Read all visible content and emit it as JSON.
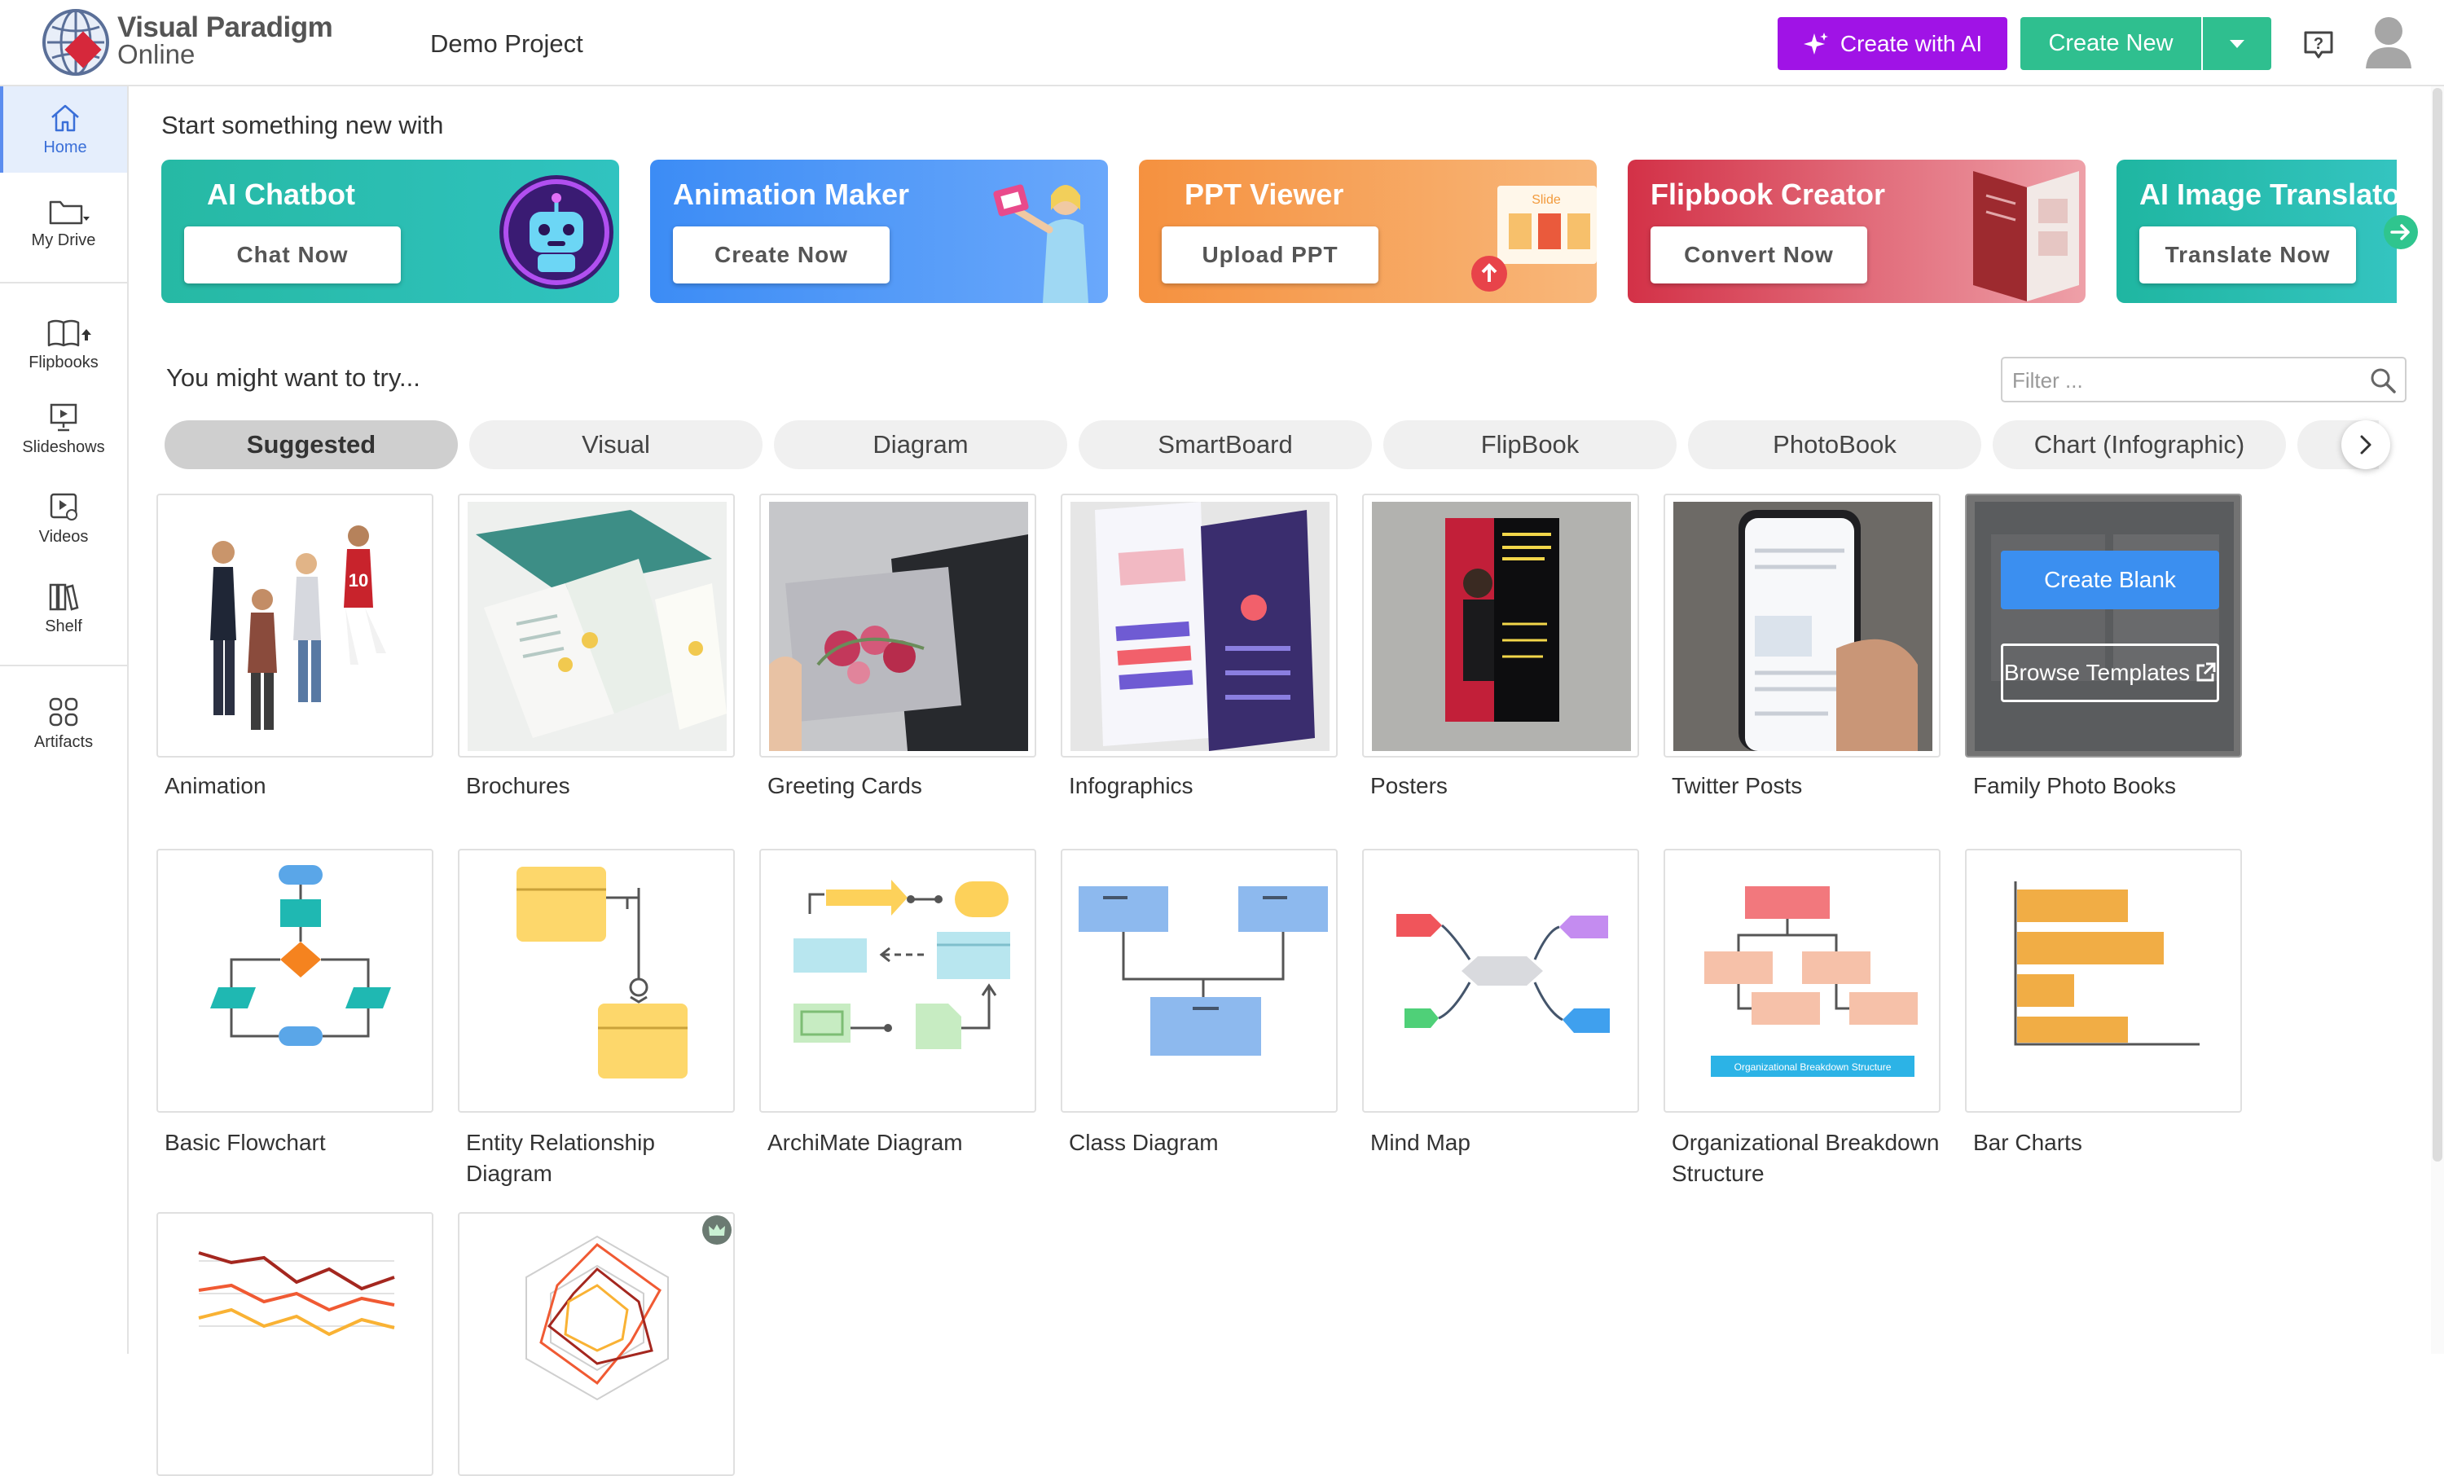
{
  "header": {
    "logo_name": "Visual Paradigm",
    "logo_sub": "Online",
    "project_name": "Demo Project",
    "ai_button": "Create with AI",
    "create_new_button": "Create New",
    "accent_ai": "#a013e6",
    "accent_green": "#2fbf8f"
  },
  "sidebar": {
    "items": [
      {
        "label": "Home",
        "icon": "home-icon"
      },
      {
        "label": "My Drive",
        "icon": "folder-icon"
      },
      {
        "label": "Flipbooks",
        "icon": "book-icon"
      },
      {
        "label": "Slideshows",
        "icon": "slideshow-icon"
      },
      {
        "label": "Videos",
        "icon": "video-icon"
      },
      {
        "label": "Shelf",
        "icon": "shelf-icon"
      },
      {
        "label": "Artifacts",
        "icon": "grid-icon"
      }
    ]
  },
  "start": {
    "heading": "Start something new with",
    "banners": [
      {
        "title": "AI Chatbot",
        "button": "Chat Now"
      },
      {
        "title": "Animation Maker",
        "button": "Create Now"
      },
      {
        "title": "PPT Viewer",
        "button": "Upload PPT",
        "art_text": "Slide"
      },
      {
        "title": "Flipbook Creator",
        "button": "Convert Now"
      },
      {
        "title": "AI Image Translato",
        "button": "Translate Now"
      }
    ]
  },
  "try": {
    "heading": "You might want to try...",
    "filter_placeholder": "Filter ...",
    "tabs": [
      "Suggested",
      "Visual",
      "Diagram",
      "SmartBoard",
      "FlipBook",
      "PhotoBook",
      "Chart (Infographic)"
    ],
    "active_tab": "Suggested"
  },
  "templates": {
    "row1": [
      "Animation",
      "Brochures",
      "Greeting Cards",
      "Infographics",
      "Posters",
      "Twitter Posts",
      "Family Photo Books"
    ],
    "row2": [
      "Basic Flowchart",
      "Entity Relationship Diagram",
      "ArchiMate Diagram",
      "Class Diagram",
      "Mind Map",
      "Organizational Breakdown Structure",
      "Bar Charts"
    ],
    "hover": {
      "create_blank": "Create Blank",
      "browse_templates": "Browse Templates"
    },
    "obs_caption": "Organizational Breakdown Structure"
  }
}
